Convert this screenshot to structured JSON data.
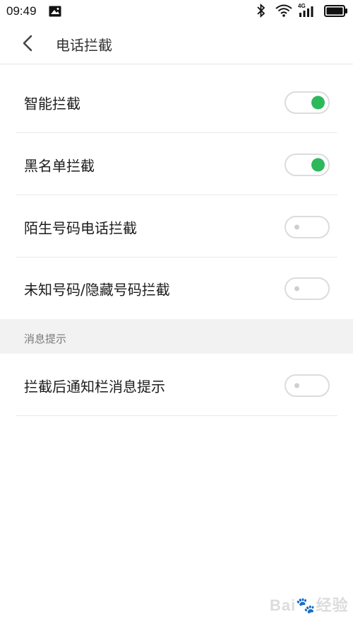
{
  "status_bar": {
    "time": "09:49",
    "network": "4G",
    "icons": [
      "image-notification-icon",
      "bluetooth-icon",
      "wifi-icon",
      "signal-icon",
      "battery-icon"
    ]
  },
  "header": {
    "title": "电话拦截",
    "back_icon": "chevron-left-icon"
  },
  "settings": [
    {
      "label": "智能拦截",
      "enabled": true
    },
    {
      "label": "黑名单拦截",
      "enabled": true
    },
    {
      "label": "陌生号码电话拦截",
      "enabled": false
    },
    {
      "label": "未知号码/隐藏号码拦截",
      "enabled": false
    }
  ],
  "section": {
    "title": "消息提示"
  },
  "notify_settings": [
    {
      "label": "拦截后通知栏消息提示",
      "enabled": false
    }
  ],
  "watermark": "Bai🐾经验",
  "colors": {
    "toggle_on": "#2eb85c",
    "toggle_off_knob": "#cfcfcf",
    "section_bg": "#f2f2f2"
  }
}
